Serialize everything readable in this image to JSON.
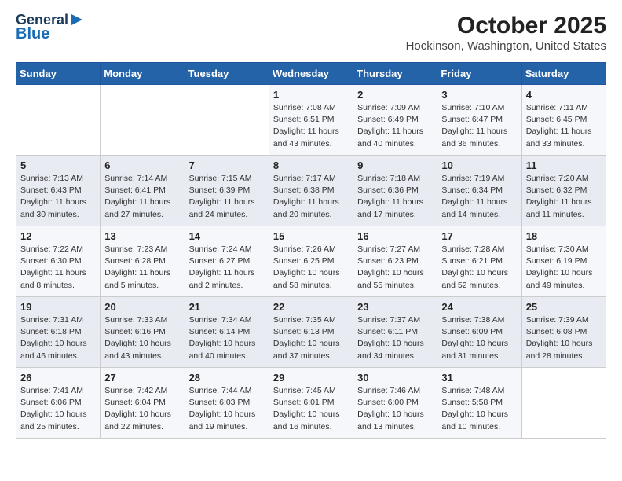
{
  "header": {
    "logo_line1": "General",
    "logo_line2": "Blue",
    "title": "October 2025",
    "subtitle": "Hockinson, Washington, United States"
  },
  "days_of_week": [
    "Sunday",
    "Monday",
    "Tuesday",
    "Wednesday",
    "Thursday",
    "Friday",
    "Saturday"
  ],
  "weeks": [
    [
      {
        "day": "",
        "detail": ""
      },
      {
        "day": "",
        "detail": ""
      },
      {
        "day": "",
        "detail": ""
      },
      {
        "day": "1",
        "detail": "Sunrise: 7:08 AM\nSunset: 6:51 PM\nDaylight: 11 hours\nand 43 minutes."
      },
      {
        "day": "2",
        "detail": "Sunrise: 7:09 AM\nSunset: 6:49 PM\nDaylight: 11 hours\nand 40 minutes."
      },
      {
        "day": "3",
        "detail": "Sunrise: 7:10 AM\nSunset: 6:47 PM\nDaylight: 11 hours\nand 36 minutes."
      },
      {
        "day": "4",
        "detail": "Sunrise: 7:11 AM\nSunset: 6:45 PM\nDaylight: 11 hours\nand 33 minutes."
      }
    ],
    [
      {
        "day": "5",
        "detail": "Sunrise: 7:13 AM\nSunset: 6:43 PM\nDaylight: 11 hours\nand 30 minutes."
      },
      {
        "day": "6",
        "detail": "Sunrise: 7:14 AM\nSunset: 6:41 PM\nDaylight: 11 hours\nand 27 minutes."
      },
      {
        "day": "7",
        "detail": "Sunrise: 7:15 AM\nSunset: 6:39 PM\nDaylight: 11 hours\nand 24 minutes."
      },
      {
        "day": "8",
        "detail": "Sunrise: 7:17 AM\nSunset: 6:38 PM\nDaylight: 11 hours\nand 20 minutes."
      },
      {
        "day": "9",
        "detail": "Sunrise: 7:18 AM\nSunset: 6:36 PM\nDaylight: 11 hours\nand 17 minutes."
      },
      {
        "day": "10",
        "detail": "Sunrise: 7:19 AM\nSunset: 6:34 PM\nDaylight: 11 hours\nand 14 minutes."
      },
      {
        "day": "11",
        "detail": "Sunrise: 7:20 AM\nSunset: 6:32 PM\nDaylight: 11 hours\nand 11 minutes."
      }
    ],
    [
      {
        "day": "12",
        "detail": "Sunrise: 7:22 AM\nSunset: 6:30 PM\nDaylight: 11 hours\nand 8 minutes."
      },
      {
        "day": "13",
        "detail": "Sunrise: 7:23 AM\nSunset: 6:28 PM\nDaylight: 11 hours\nand 5 minutes."
      },
      {
        "day": "14",
        "detail": "Sunrise: 7:24 AM\nSunset: 6:27 PM\nDaylight: 11 hours\nand 2 minutes."
      },
      {
        "day": "15",
        "detail": "Sunrise: 7:26 AM\nSunset: 6:25 PM\nDaylight: 10 hours\nand 58 minutes."
      },
      {
        "day": "16",
        "detail": "Sunrise: 7:27 AM\nSunset: 6:23 PM\nDaylight: 10 hours\nand 55 minutes."
      },
      {
        "day": "17",
        "detail": "Sunrise: 7:28 AM\nSunset: 6:21 PM\nDaylight: 10 hours\nand 52 minutes."
      },
      {
        "day": "18",
        "detail": "Sunrise: 7:30 AM\nSunset: 6:19 PM\nDaylight: 10 hours\nand 49 minutes."
      }
    ],
    [
      {
        "day": "19",
        "detail": "Sunrise: 7:31 AM\nSunset: 6:18 PM\nDaylight: 10 hours\nand 46 minutes."
      },
      {
        "day": "20",
        "detail": "Sunrise: 7:33 AM\nSunset: 6:16 PM\nDaylight: 10 hours\nand 43 minutes."
      },
      {
        "day": "21",
        "detail": "Sunrise: 7:34 AM\nSunset: 6:14 PM\nDaylight: 10 hours\nand 40 minutes."
      },
      {
        "day": "22",
        "detail": "Sunrise: 7:35 AM\nSunset: 6:13 PM\nDaylight: 10 hours\nand 37 minutes."
      },
      {
        "day": "23",
        "detail": "Sunrise: 7:37 AM\nSunset: 6:11 PM\nDaylight: 10 hours\nand 34 minutes."
      },
      {
        "day": "24",
        "detail": "Sunrise: 7:38 AM\nSunset: 6:09 PM\nDaylight: 10 hours\nand 31 minutes."
      },
      {
        "day": "25",
        "detail": "Sunrise: 7:39 AM\nSunset: 6:08 PM\nDaylight: 10 hours\nand 28 minutes."
      }
    ],
    [
      {
        "day": "26",
        "detail": "Sunrise: 7:41 AM\nSunset: 6:06 PM\nDaylight: 10 hours\nand 25 minutes."
      },
      {
        "day": "27",
        "detail": "Sunrise: 7:42 AM\nSunset: 6:04 PM\nDaylight: 10 hours\nand 22 minutes."
      },
      {
        "day": "28",
        "detail": "Sunrise: 7:44 AM\nSunset: 6:03 PM\nDaylight: 10 hours\nand 19 minutes."
      },
      {
        "day": "29",
        "detail": "Sunrise: 7:45 AM\nSunset: 6:01 PM\nDaylight: 10 hours\nand 16 minutes."
      },
      {
        "day": "30",
        "detail": "Sunrise: 7:46 AM\nSunset: 6:00 PM\nDaylight: 10 hours\nand 13 minutes."
      },
      {
        "day": "31",
        "detail": "Sunrise: 7:48 AM\nSunset: 5:58 PM\nDaylight: 10 hours\nand 10 minutes."
      },
      {
        "day": "",
        "detail": ""
      }
    ]
  ]
}
